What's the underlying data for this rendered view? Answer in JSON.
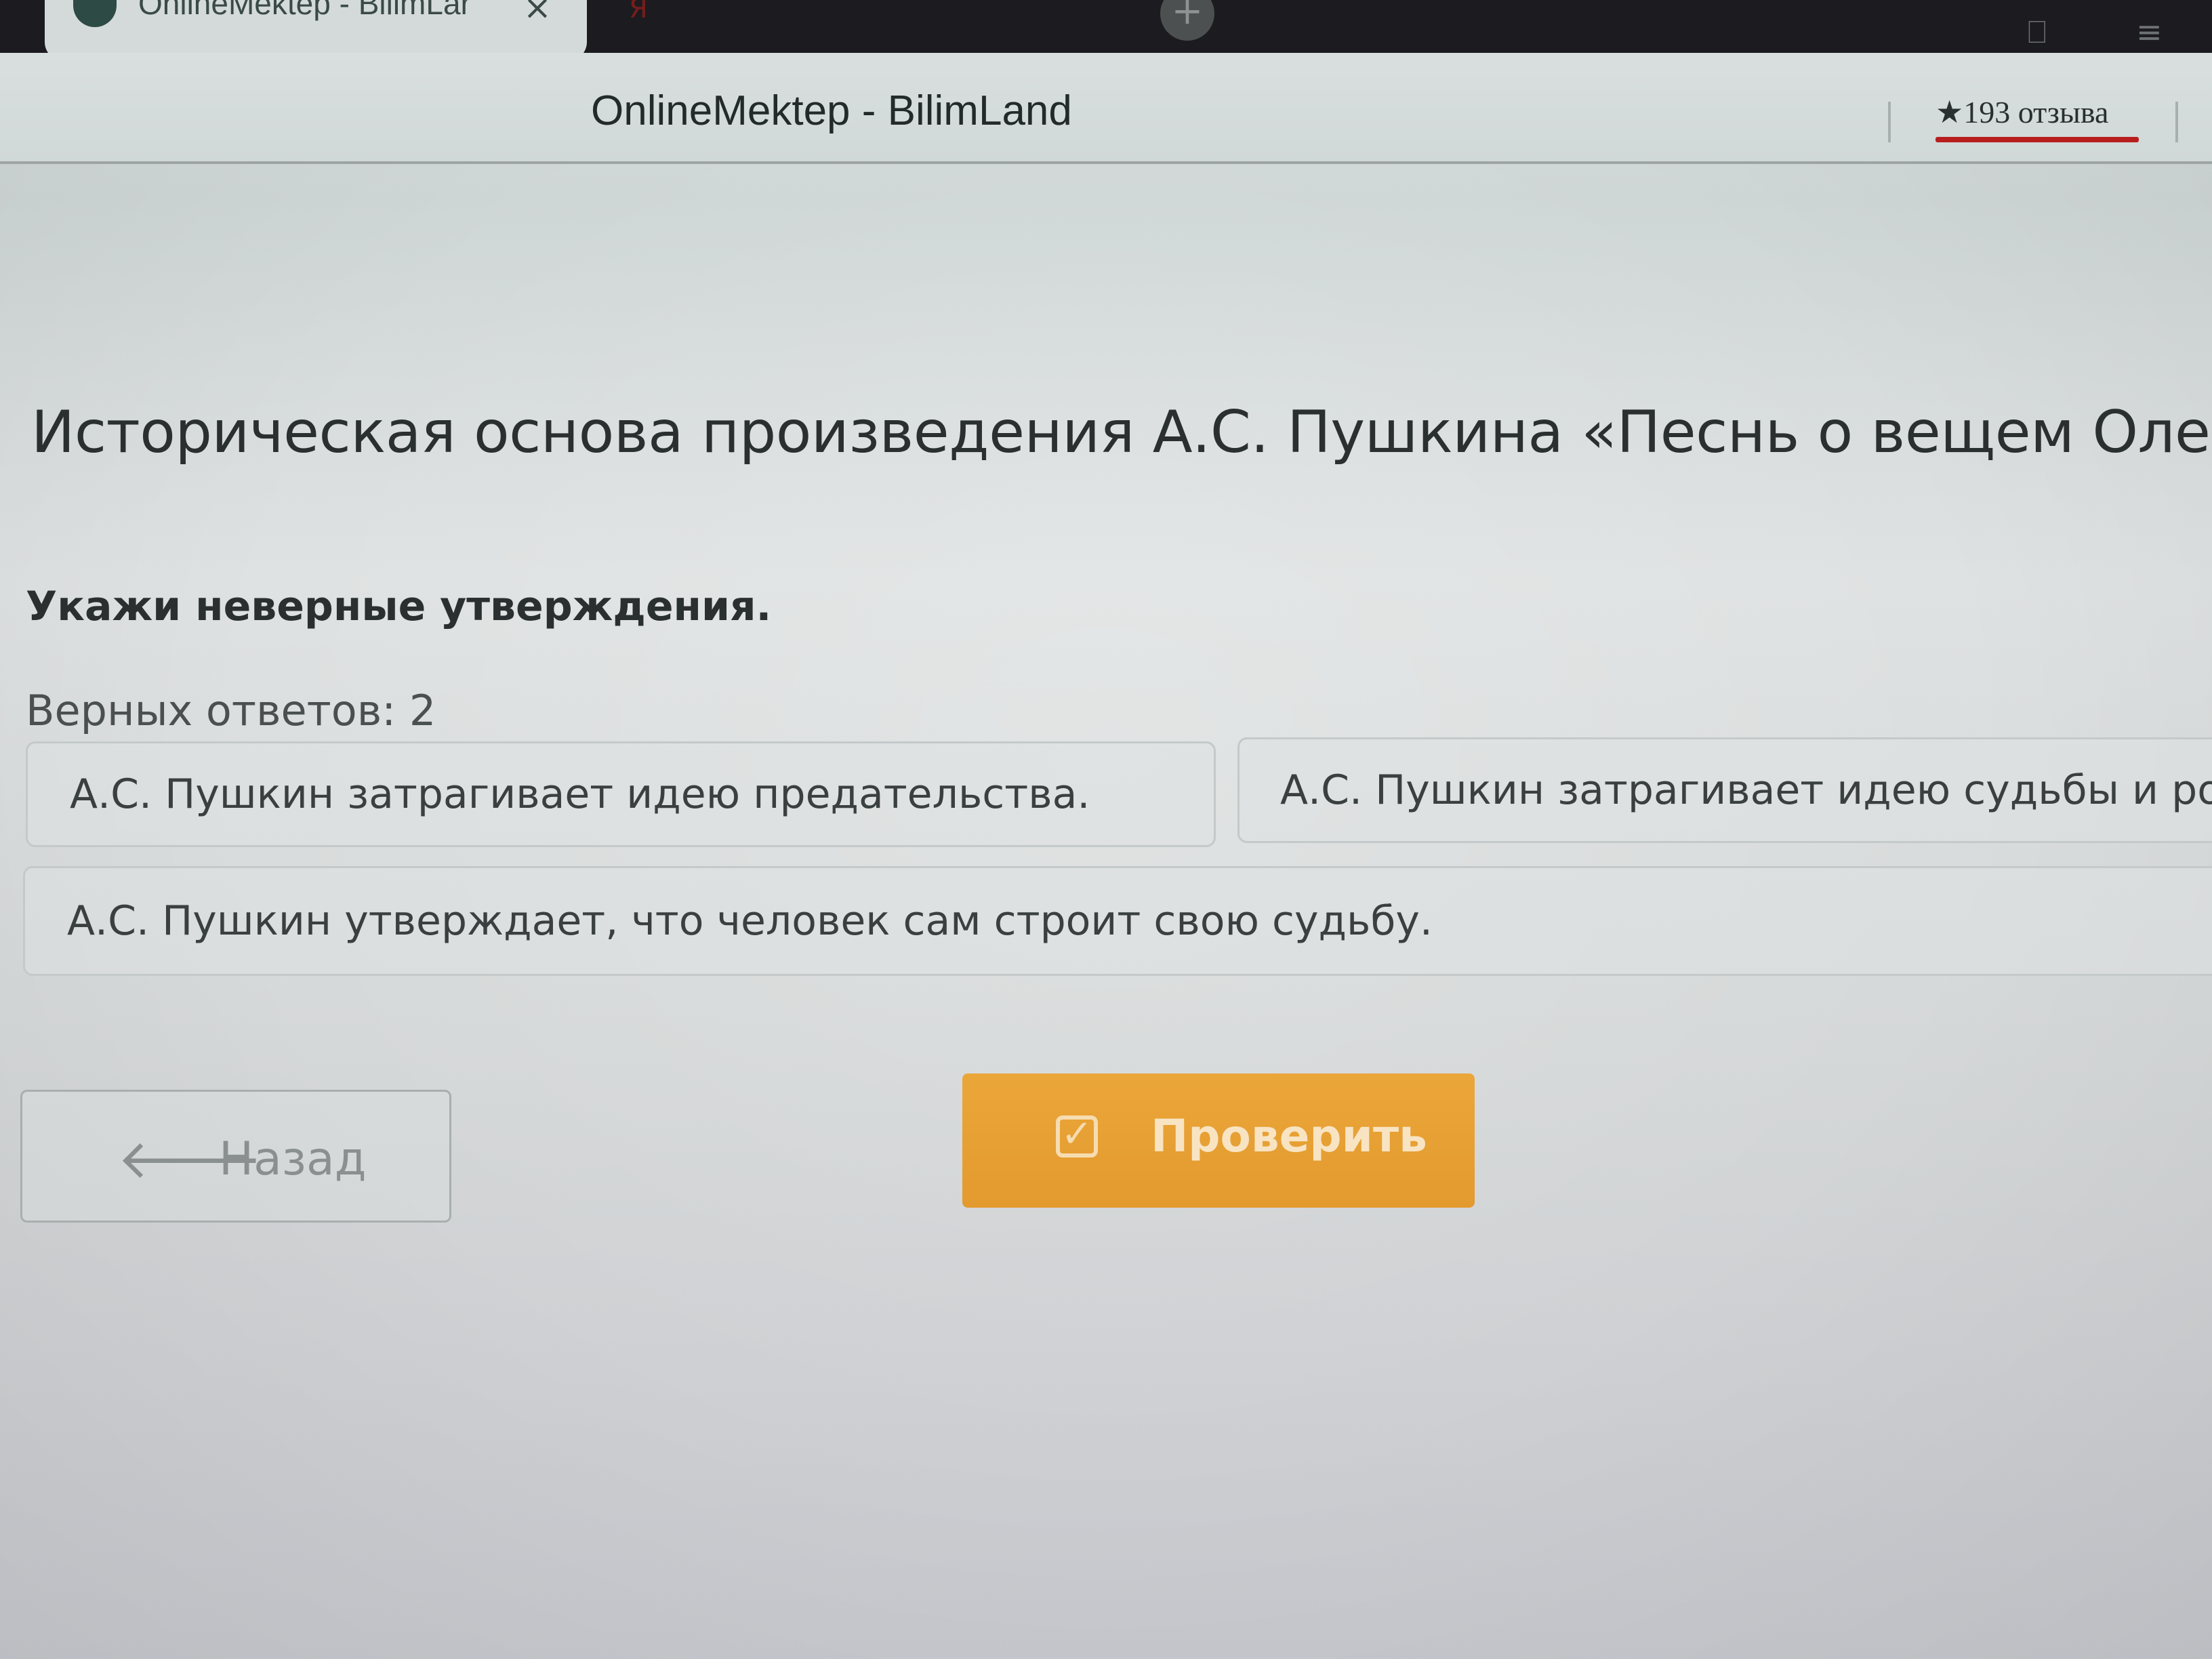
{
  "browser": {
    "tab_title": "OnlineMektep - BilimLar",
    "tab_close": "×",
    "other_tab_icon": "Я",
    "other_tab_text": "",
    "newtab_label": "+",
    "bookmark_icon": "bookmark-icon",
    "menu_icon": "menu-icon"
  },
  "addressbar": {
    "site_title": "OnlineMektep - BilimLand",
    "reviews": "★193 отзыва"
  },
  "page": {
    "title": "Историческая основа произведения А.С. Пушкина «Песнь о вещем Олеге»",
    "prompt": "Укажи неверные утверждения.",
    "answers_count": "Верных ответов: 2",
    "options": [
      "А.С. Пушкин затрагивает идею предательства.",
      "А.С. Пушкин затрагивает идею судьбы и рока.",
      "А.С. Пушкин утверждает, что человек сам строит свою судьбу."
    ],
    "back_label": "Назад",
    "check_label": "Проверить"
  },
  "colors": {
    "accent": "#e39a2e",
    "reviews_underline": "#b81e1e",
    "text": "#2a2f30"
  }
}
